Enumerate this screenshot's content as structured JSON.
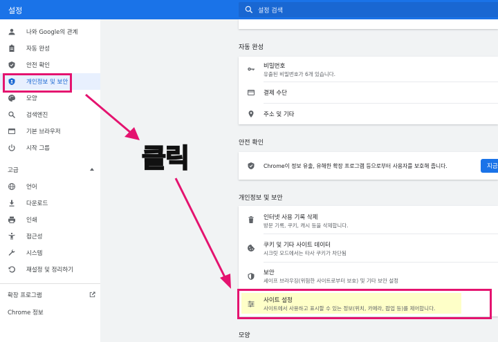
{
  "header": {
    "title": "설정",
    "search_placeholder": "설정 검색"
  },
  "sidebar": {
    "items": [
      {
        "label": "나와 Google의 관계",
        "icon": "person-icon"
      },
      {
        "label": "자동 완성",
        "icon": "clipboard-icon"
      },
      {
        "label": "안전 확인",
        "icon": "shield-check-icon"
      },
      {
        "label": "개인정보 및 보안",
        "icon": "shield-icon",
        "active": true
      },
      {
        "label": "모양",
        "icon": "palette-icon"
      },
      {
        "label": "검색엔진",
        "icon": "search-icon"
      },
      {
        "label": "기본 브라우저",
        "icon": "browser-icon"
      },
      {
        "label": "시작 그룹",
        "icon": "power-icon"
      }
    ],
    "advanced_label": "고급",
    "advanced_items": [
      {
        "label": "언어",
        "icon": "globe-icon"
      },
      {
        "label": "다운로드",
        "icon": "download-icon"
      },
      {
        "label": "인쇄",
        "icon": "printer-icon"
      },
      {
        "label": "접근성",
        "icon": "accessibility-icon"
      },
      {
        "label": "시스템",
        "icon": "wrench-icon"
      },
      {
        "label": "재설정 및 정리하기",
        "icon": "restore-icon"
      }
    ],
    "extensions_label": "확장 프로그램",
    "about_label": "Chrome 정보"
  },
  "main": {
    "autofill": {
      "title": "자동 완성",
      "rows": [
        {
          "title": "비밀번호",
          "subtitle": "유출된 비밀번호가 6개 있습니다.",
          "icon": "key-icon"
        },
        {
          "title": "결제 수단",
          "icon": "credit-card-icon"
        },
        {
          "title": "주소 및 기타",
          "icon": "location-pin-icon"
        }
      ]
    },
    "safety": {
      "title": "안전 확인",
      "text": "Chrome이 정보 유출, 유해한 확장 프로그램 등으로부터 사용자를 보호해 줍니다.",
      "button": "지금"
    },
    "privacy": {
      "title": "개인정보 및 보안",
      "rows": [
        {
          "title": "인터넷 사용 기록 삭제",
          "subtitle": "방문 기록, 쿠키, 캐시 등을 삭제합니다.",
          "icon": "trash-icon"
        },
        {
          "title": "쿠키 및 기타 사이트 데이터",
          "subtitle": "시크릿 모드에서는 타사 쿠키가 차단됨",
          "icon": "cookie-icon"
        },
        {
          "title": "보안",
          "subtitle": "세이프 브라우징(위험한 사이트로부터 보호) 및 기타 보안 설정",
          "icon": "security-shield-icon"
        },
        {
          "title": "사이트 설정",
          "subtitle": "사이트에서 사용하고 표시할 수 있는 정보(위치, 카메라, 팝업 등)를 제어합니다.",
          "icon": "sliders-icon"
        }
      ]
    },
    "appearance_title": "모양"
  },
  "annotation": {
    "text": "클릭",
    "color": "#e4136f",
    "text_color": "#ffff00"
  },
  "colors": {
    "accent": "#1a73e8",
    "active_bg": "#e8f0fe",
    "highlight": "#feffc8"
  }
}
